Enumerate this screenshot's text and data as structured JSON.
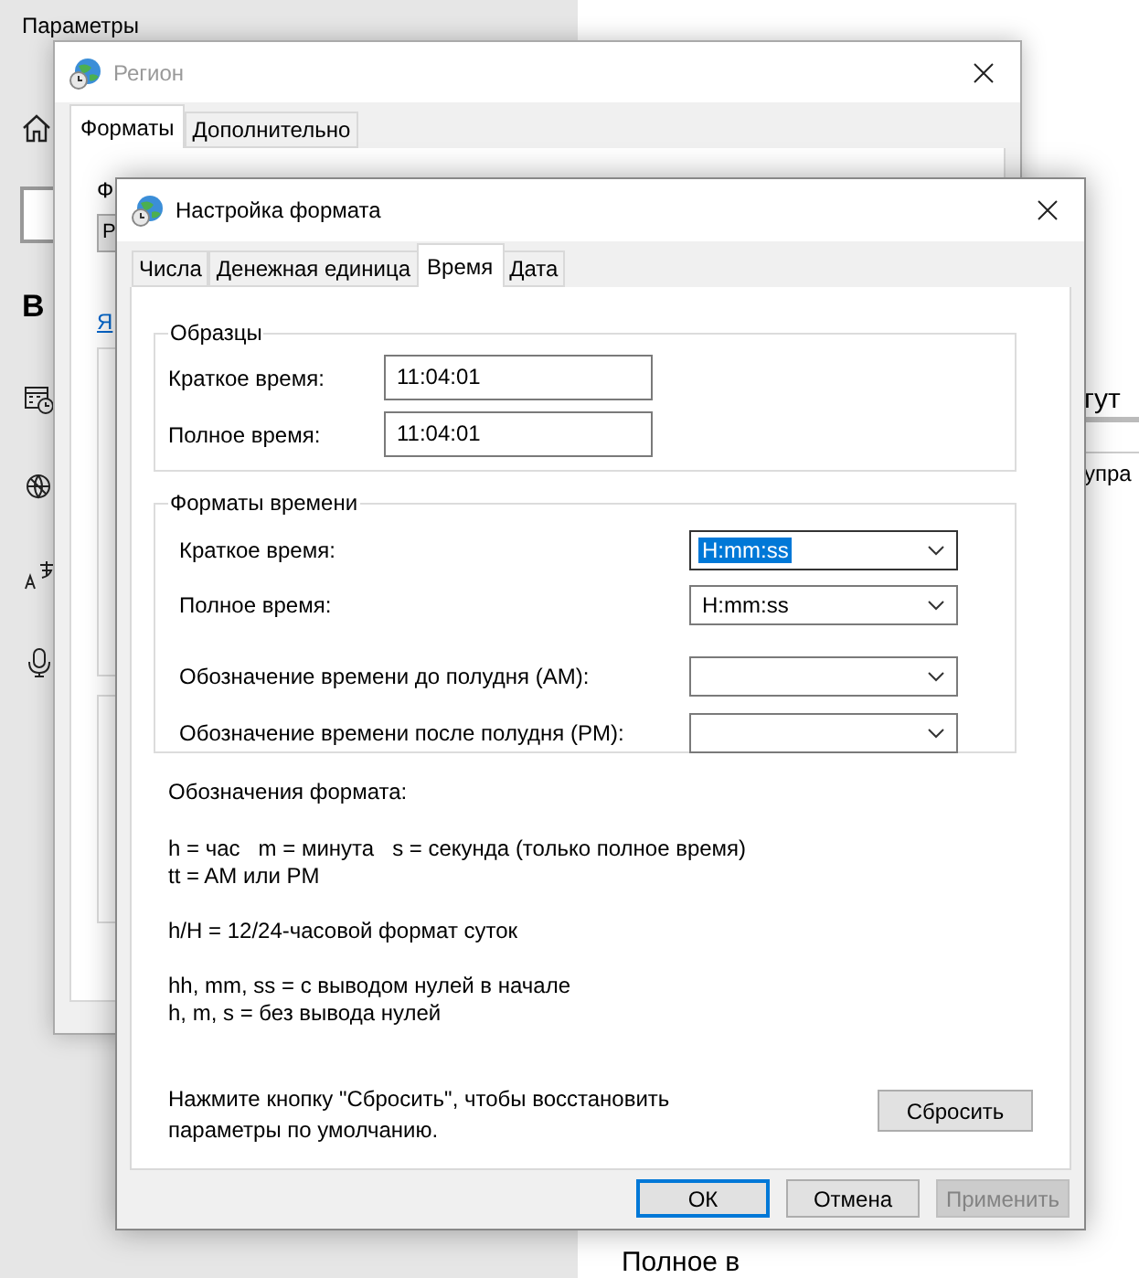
{
  "settings": {
    "title": "Параметры",
    "heading": "В",
    "right_texts": [
      "гут",
      "упра",
      "Полное в"
    ]
  },
  "region_window": {
    "title": "Регион",
    "tabs": [
      {
        "label": "Форматы",
        "selected": true
      },
      {
        "label": "Дополнительно",
        "selected": false
      }
    ],
    "format_label": "Ф",
    "format_value": "Р",
    "link": "Я"
  },
  "format_dialog": {
    "title": "Настройка формата",
    "tabs": [
      {
        "label": "Числа",
        "selected": false
      },
      {
        "label": "Денежная единица",
        "selected": false
      },
      {
        "label": "Время",
        "selected": true
      },
      {
        "label": "Дата",
        "selected": false
      }
    ],
    "samples": {
      "title": "Образцы",
      "rows": [
        {
          "label": "Краткое время:",
          "value": "11:04:01"
        },
        {
          "label": "Полное время:",
          "value": "11:04:01"
        }
      ]
    },
    "time_formats": {
      "title": "Форматы времени",
      "rows": [
        {
          "label": "Краткое время:",
          "value": "H:mm:ss",
          "focused": true
        },
        {
          "label": "Полное время:",
          "value": "H:mm:ss",
          "focused": false
        },
        {
          "label": "Обозначение времени до полудня (AM):",
          "focused": false
        },
        {
          "label": "Обозначение времени после полудня (PM):",
          "focused": false
        }
      ]
    },
    "legend": {
      "title": "Обозначения формата:",
      "paragraphs": [
        [
          "h = час   m = минута   s = секунда (только полное время)",
          "tt = AM или PM"
        ],
        [
          "h/H = 12/24-часовой формат суток"
        ],
        [
          "hh, mm, ss = с выводом нулей в начале",
          "h, m, s = без вывода нулей"
        ]
      ]
    },
    "reset_note": "Нажмите кнопку \"Сбросить\", чтобы восстановить параметры по умолчанию.",
    "reset_button": "Сбросить",
    "buttons": [
      {
        "label": "ОК",
        "kind": "default",
        "disabled": false
      },
      {
        "label": "Отмена",
        "kind": "normal",
        "disabled": false
      },
      {
        "label": "Применить",
        "kind": "normal",
        "disabled": true
      }
    ]
  }
}
